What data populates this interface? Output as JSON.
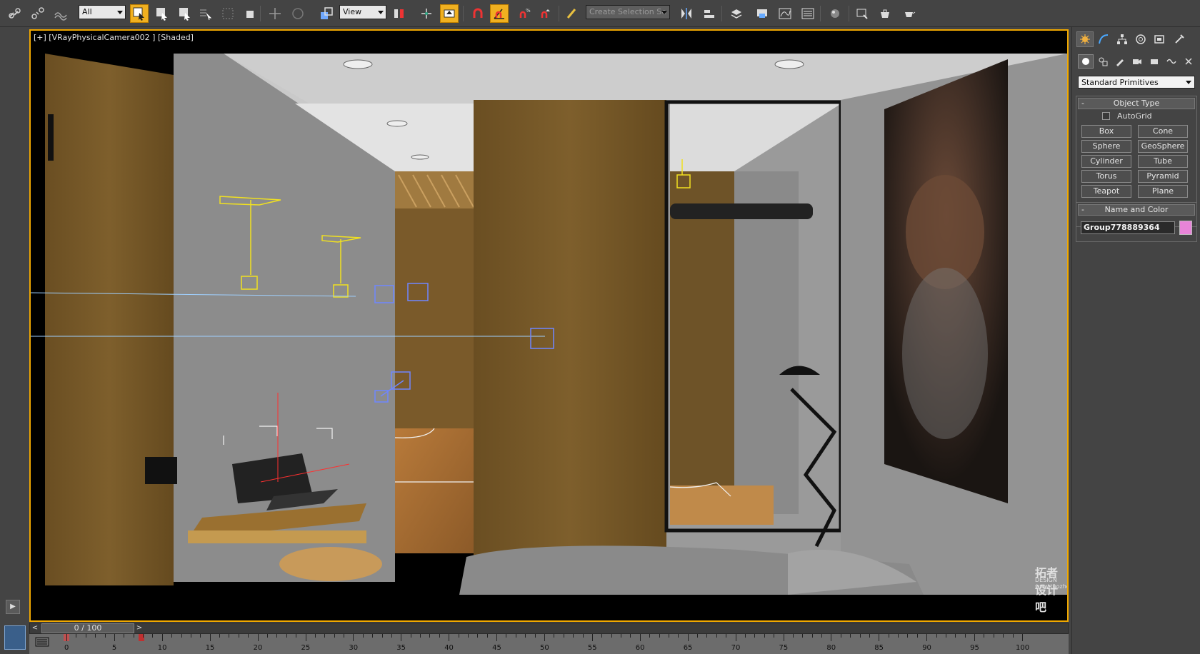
{
  "toolbar": {
    "selection_filter": "All",
    "coordinate_system": "View",
    "named_selection_placeholder": "Create Selection Se",
    "icons": [
      "link-icon",
      "unlink-icon",
      "bind-spacewarp-icon",
      "select-object-icon",
      "select-by-name-icon",
      "rectangular-selection-icon",
      "window-crossing-icon",
      "select-move-icon",
      "select-rotate-icon",
      "select-scale-icon",
      "pivot-icon",
      "snap-toggle-icon",
      "angle-snap-icon",
      "percent-snap-icon",
      "spinner-snap-icon",
      "edit-named-selection-icon",
      "mirror-icon",
      "align-icon",
      "layer-manager-icon",
      "graphite-tools-icon",
      "curve-editor-icon",
      "schematic-view-icon",
      "material-editor-icon",
      "render-setup-icon",
      "rendered-frame-icon",
      "render-production-icon"
    ]
  },
  "viewport": {
    "label": "[+] [VRayPhysicalCamera002 ] [Shaded]"
  },
  "command_panel": {
    "category": "Standard Primitives",
    "object_type": {
      "title": "Object Type",
      "autogrid_label": "AutoGrid",
      "buttons": [
        "Box",
        "Cone",
        "Sphere",
        "GeoSphere",
        "Cylinder",
        "Tube",
        "Torus",
        "Pyramid",
        "Teapot",
        "Plane"
      ]
    },
    "name_and_color": {
      "title": "Name and Color",
      "name": "Group778889364",
      "color": "#e884d8"
    }
  },
  "timeline": {
    "frame_display": "0 / 100",
    "ticks": [
      "0",
      "5",
      "10",
      "15",
      "20",
      "25",
      "30",
      "35",
      "40",
      "45",
      "50",
      "55",
      "60",
      "65",
      "70",
      "75",
      "80",
      "85",
      "90",
      "95",
      "100"
    ]
  },
  "watermark": {
    "line1": "拓者设计吧",
    "line2": "DESIGN  www.tuozhe8.com"
  }
}
